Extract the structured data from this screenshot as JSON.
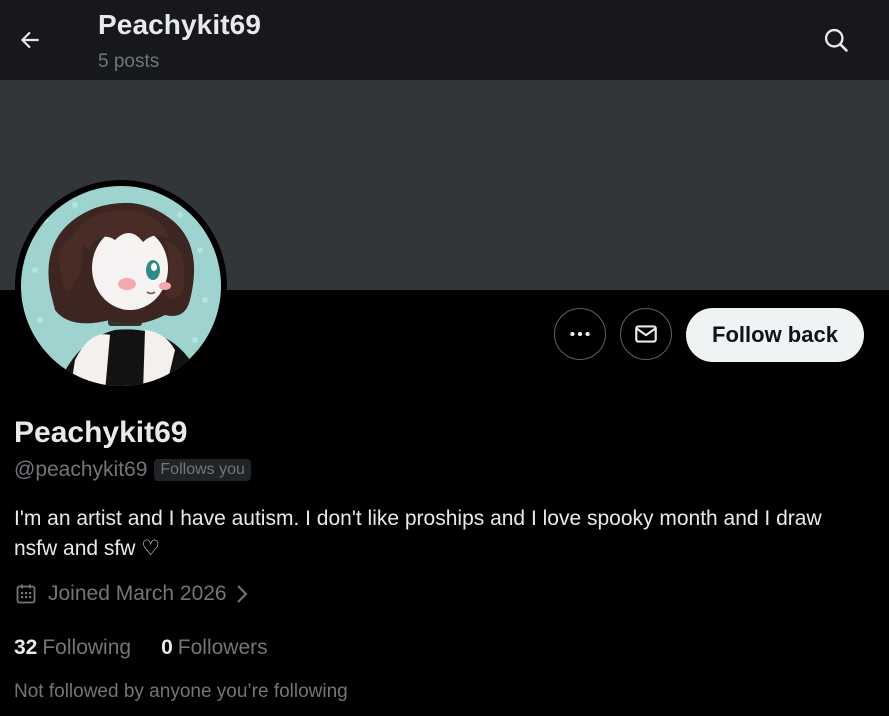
{
  "header": {
    "title": "Peachykit69",
    "post_count": "5 posts",
    "back_icon": "arrow-left-icon",
    "search_icon": "search-icon"
  },
  "banner": {
    "color": "#333639"
  },
  "actions": {
    "more_icon": "more-dots-icon",
    "message_icon": "envelope-icon",
    "follow_label": "Follow back"
  },
  "profile": {
    "display_name": "Peachykit69",
    "handle": "@peachykit69",
    "follows_you": "Follows you",
    "bio": "I'm an artist and I have autism. I don't like proships and I love spooky month and I draw nsfw and sfw ♡",
    "joined": "Joined March 2026",
    "following_count": "32",
    "following_label": "Following",
    "followers_count": "0",
    "followers_label": "Followers",
    "not_followed_note": "Not followed by anyone you’re following"
  },
  "colors": {
    "background": "#000000",
    "header_bg": "#16181c",
    "muted_text": "#71767b",
    "primary_text": "#e7e9ea",
    "button_bg": "#eff3f4",
    "avatar_bg": "#9ed3d0"
  }
}
